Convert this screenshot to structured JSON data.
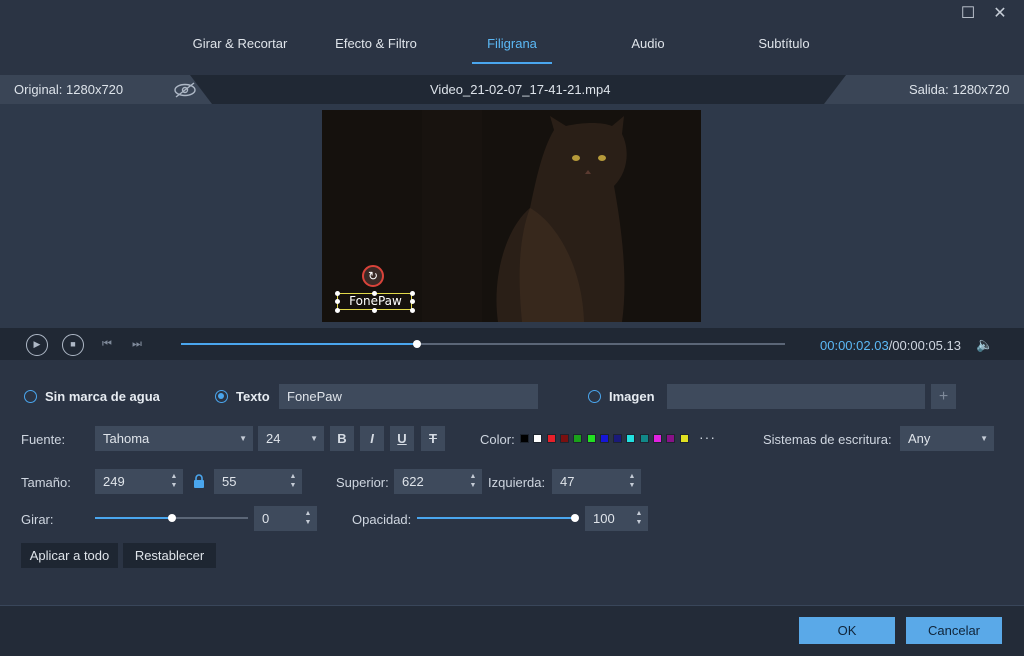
{
  "window": {
    "maximize_icon": "maximize-icon",
    "close_icon": "close-icon"
  },
  "tabs": [
    {
      "label": "Girar & Recortar"
    },
    {
      "label": "Efecto & Filtro"
    },
    {
      "label": "Filigrana"
    },
    {
      "label": "Audio"
    },
    {
      "label": "Subtítulo"
    }
  ],
  "active_tab": "Filigrana",
  "infobar": {
    "original": "Original: 1280x720",
    "filename": "Video_21-02-07_17-41-21.mp4",
    "output": "Salida: 1280x720"
  },
  "preview": {
    "watermark_text": "FonePaw"
  },
  "player": {
    "current_time": "00:00:02.03",
    "total_time": "/00:00:05.13",
    "progress": 0.39
  },
  "watermark": {
    "none_label": "Sin marca de agua",
    "text_label": "Texto",
    "text_value": "FonePaw",
    "image_label": "Imagen",
    "image_value": "",
    "add_symbol": "+",
    "selected": "Texto"
  },
  "font": {
    "label": "Fuente:",
    "family": "Tahoma",
    "size": "24",
    "bold": "B",
    "italic": "I",
    "underline": "U",
    "strike": "T",
    "color_label": "Color:",
    "colors": [
      "#000000",
      "#ffffff",
      "#e8202a",
      "#7a1010",
      "#1aa11a",
      "#22e022",
      "#1616d8",
      "#1a1a7a",
      "#22e0e0",
      "#118888",
      "#e022e0",
      "#881188",
      "#e0e022"
    ],
    "more_colors": "···",
    "script_label": "Sistemas de escritura:",
    "script_value": "Any"
  },
  "size": {
    "label": "Tamaño:",
    "width": "249",
    "height": "55",
    "top_label": "Superior:",
    "top_value": "622",
    "left_label": "Izquierda:",
    "left_value": "47"
  },
  "rotate": {
    "label": "Girar:",
    "value": "0",
    "slider_fraction": 0.5
  },
  "opacity": {
    "label": "Opacidad:",
    "value": "100",
    "slider_fraction": 1.0
  },
  "actions": {
    "apply_all": "Aplicar a todo",
    "reset": "Restablecer"
  },
  "footer": {
    "ok": "OK",
    "cancel": "Cancelar"
  },
  "accent_color": "#4aa6ee"
}
